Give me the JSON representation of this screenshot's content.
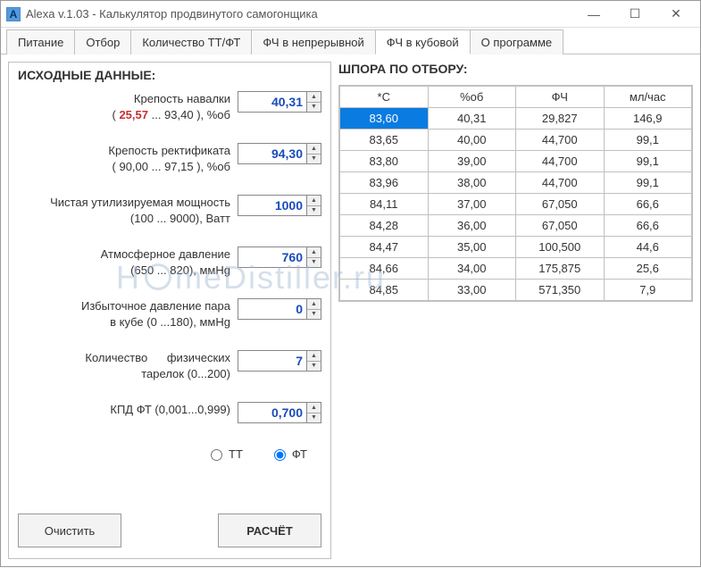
{
  "window": {
    "title": "Alexa  v.1.03 - Калькулятор продвинутого самогонщика"
  },
  "tabs": [
    "Питание",
    "Отбор",
    "Количество ТТ/ФТ",
    "ФЧ в непрерывной",
    "ФЧ в кубовой",
    "О программе"
  ],
  "activeTab": 4,
  "left": {
    "heading": "ИСХОДНЫЕ ДАННЫЕ:",
    "fields": {
      "feed_strength": {
        "label": "Крепость навалки",
        "range_pre": "(",
        "range_min": "25,57",
        "range_mid": " ...      93,40    ), %об",
        "value": "40,31"
      },
      "rect_strength": {
        "label": "Крепость ректификата",
        "range": "(     90,00   ...   97,15  ), %об",
        "value": "94,30"
      },
      "power": {
        "label": "Чистая утилизируемая мощность",
        "range": "(100 ... 9000), Ватт",
        "value": "1000"
      },
      "atm_pressure": {
        "label": "Атмосферное давление",
        "range": "(650 ... 820), ммHg",
        "value": "760"
      },
      "over_pressure": {
        "label": "Избыточное давление пара",
        "range": "в кубе (0 ...180), ммHg",
        "value": "0"
      },
      "plates": {
        "label1": "Количество",
        "label2": "физических",
        "range": "тарелок (0...200)",
        "value": "7"
      },
      "kpd": {
        "label": "КПД ФТ (0,001...0,999)",
        "value": "0,700"
      }
    },
    "radios": {
      "tt": "ТТ",
      "ft": "ФТ",
      "selected": "ft"
    },
    "buttons": {
      "clear": "Очистить",
      "calc": "РАСЧЁТ"
    }
  },
  "right": {
    "heading": "ШПОРА ПО ОТБОРУ:",
    "headers": [
      "*C",
      "%об",
      "ФЧ",
      "мл/час"
    ],
    "rows": [
      [
        "83,60",
        "40,31",
        "29,827",
        "146,9"
      ],
      [
        "83,65",
        "40,00",
        "44,700",
        "99,1"
      ],
      [
        "83,80",
        "39,00",
        "44,700",
        "99,1"
      ],
      [
        "83,96",
        "38,00",
        "44,700",
        "99,1"
      ],
      [
        "84,11",
        "37,00",
        "67,050",
        "66,6"
      ],
      [
        "84,28",
        "36,00",
        "67,050",
        "66,6"
      ],
      [
        "84,47",
        "35,00",
        "100,500",
        "44,6"
      ],
      [
        "84,66",
        "34,00",
        "175,875",
        "25,6"
      ],
      [
        "84,85",
        "33,00",
        "571,350",
        "7,9"
      ]
    ],
    "selectedRow": 0
  },
  "watermark": "HomeDistiller.ru"
}
